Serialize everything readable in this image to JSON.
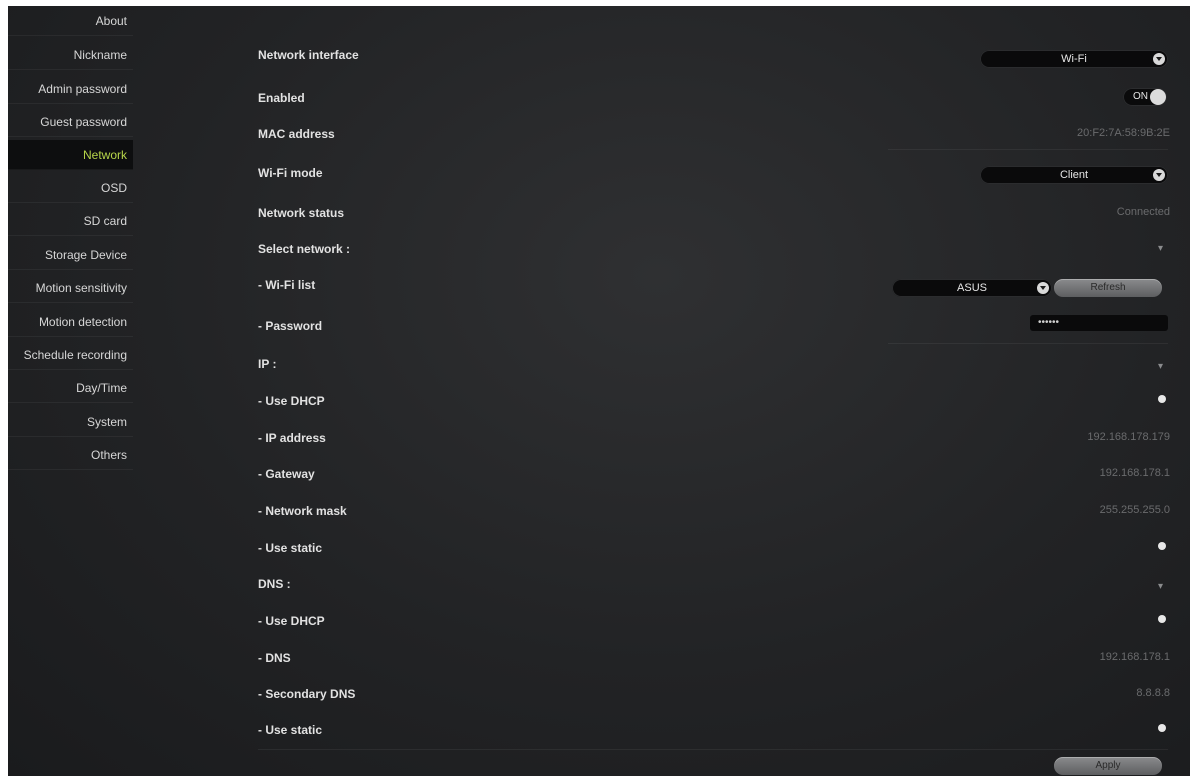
{
  "sidebar": {
    "items": [
      {
        "label": "About",
        "active": false
      },
      {
        "label": "Nickname",
        "active": false
      },
      {
        "label": "Admin password",
        "active": false
      },
      {
        "label": "Guest password",
        "active": false
      },
      {
        "label": "Network",
        "active": true
      },
      {
        "label": "OSD",
        "active": false
      },
      {
        "label": "SD card",
        "active": false
      },
      {
        "label": "Storage Device",
        "active": false
      },
      {
        "label": "Motion sensitivity",
        "active": false
      },
      {
        "label": "Motion detection",
        "active": false
      },
      {
        "label": "Schedule recording",
        "active": false
      },
      {
        "label": "Day/Time",
        "active": false
      },
      {
        "label": "System",
        "active": false
      },
      {
        "label": "Others",
        "active": false
      }
    ],
    "active_color": "#b7d64a"
  },
  "network": {
    "interface": {
      "label": "Network interface",
      "value": "Wi-Fi"
    },
    "enabled": {
      "label": "Enabled",
      "value": "ON"
    },
    "mac": {
      "label": "MAC address",
      "value": "20:F2:7A:58:9B:2E"
    },
    "wifi_mode": {
      "label": "Wi-Fi mode",
      "value": "Client"
    },
    "status": {
      "label": "Network status",
      "value": "Connected"
    },
    "select_network": {
      "label": "Select network :"
    },
    "wifi_list": {
      "label": "- Wi-Fi list",
      "value": "ASUS",
      "refresh_label": "Refresh"
    },
    "password": {
      "label": "- Password",
      "value": "••••••"
    },
    "ip": {
      "label": "IP :",
      "use_dhcp": "- Use DHCP",
      "ip_address": {
        "label": "- IP address",
        "value": "192.168.178.179"
      },
      "gateway": {
        "label": "- Gateway",
        "value": "192.168.178.1"
      },
      "mask": {
        "label": "- Network mask",
        "value": "255.255.255.0"
      },
      "use_static": "- Use static"
    },
    "dns": {
      "label": "DNS :",
      "use_dhcp": "- Use DHCP",
      "dns1": {
        "label": "- DNS",
        "value": "192.168.178.1"
      },
      "dns2": {
        "label": "- Secondary DNS",
        "value": "8.8.8.8"
      },
      "use_static": "- Use static"
    },
    "apply_label": "Apply"
  }
}
